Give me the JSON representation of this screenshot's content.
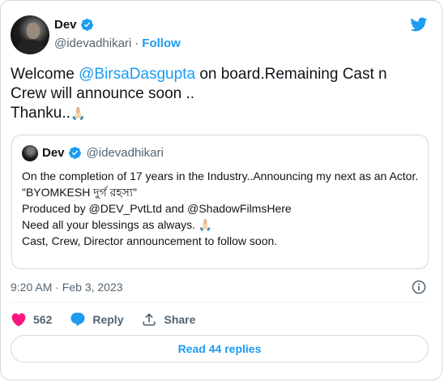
{
  "author": {
    "name": "Dev",
    "handle": "@idevadhikari",
    "separator": "·",
    "follow_label": "Follow"
  },
  "tweet": {
    "line1_before": "Welcome ",
    "mention": "@BirsaDasgupta",
    "line1_after": " on board.Remaining Cast n",
    "line2": "Crew will announce soon ..",
    "line3": "Thanku..",
    "emoji": "🙏🏻"
  },
  "quoted": {
    "name": "Dev",
    "handle": "@idevadhikari",
    "text": "On the completion of 17 years in the Industry..Announcing my next as an Actor.\n\"BYOMKESH দুর্গ রহস্য\"\nProduced by @DEV_PvtLtd and @ShadowFilmsHere\nNeed all your blessings as always. 🙏🏻\nCast, Crew, Director announcement to follow soon."
  },
  "timestamp": "9:20 AM · Feb 3, 2023",
  "actions": {
    "likes": "562",
    "reply_label": "Reply",
    "share_label": "Share"
  },
  "read_replies": "Read 44 replies",
  "colors": {
    "accent": "#1d9bf0",
    "like": "#f91880",
    "text": "#0f1419",
    "muted": "#536471"
  }
}
